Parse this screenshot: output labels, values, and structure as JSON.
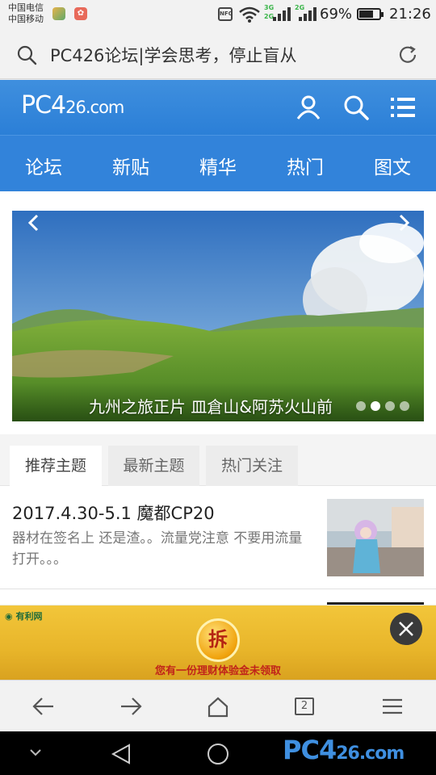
{
  "status_bar": {
    "carrier_1": "中国电信",
    "carrier_2": "中国移动",
    "nfc": "NFC",
    "net_3g": "3G",
    "net_2g_a": "2G",
    "net_2g_b": "2G",
    "battery_percent": "69%",
    "battery_level": 0.69,
    "time": "21:26"
  },
  "address_bar": {
    "title": "PC426论坛|学会思考，停止盲从",
    "search_icon": "search-icon",
    "reload_icon": "reload-icon"
  },
  "header": {
    "logo_main": "PC4",
    "logo_small": "26.com",
    "icons": [
      "user-icon",
      "search-icon",
      "menu-icon"
    ]
  },
  "nav": {
    "items": [
      {
        "label": "论坛"
      },
      {
        "label": "新贴"
      },
      {
        "label": "精华"
      },
      {
        "label": "热门"
      },
      {
        "label": "图文"
      }
    ]
  },
  "banner": {
    "caption": "九州之旅正片 皿倉山&阿苏火山前",
    "slide_count": 4,
    "active_slide": 2
  },
  "tabs": [
    {
      "label": "推荐主题",
      "active": true
    },
    {
      "label": "最新主题",
      "active": false
    },
    {
      "label": "热门关注",
      "active": false
    }
  ],
  "posts": [
    {
      "title": "2017.4.30-5.1 魔都CP20",
      "excerpt": "器材在签名上 还是渣。。流量党注意 不要用流量打开。。。"
    }
  ],
  "ad": {
    "brand": "有利网",
    "coin_char": "拆",
    "text": "您有一份理财体验金未领取"
  },
  "toolbar": {
    "tab_count": "2",
    "icons": [
      "back-arrow-icon",
      "forward-arrow-icon",
      "home-icon",
      "tabs-icon",
      "menu-icon"
    ]
  },
  "system_nav": {
    "watermark_main": "PC4",
    "watermark_small": "26.com"
  },
  "colors": {
    "brand_blue": "#2b7fd7",
    "nav_blue": "#3283da",
    "ad_yellow": "#f2c63a"
  }
}
